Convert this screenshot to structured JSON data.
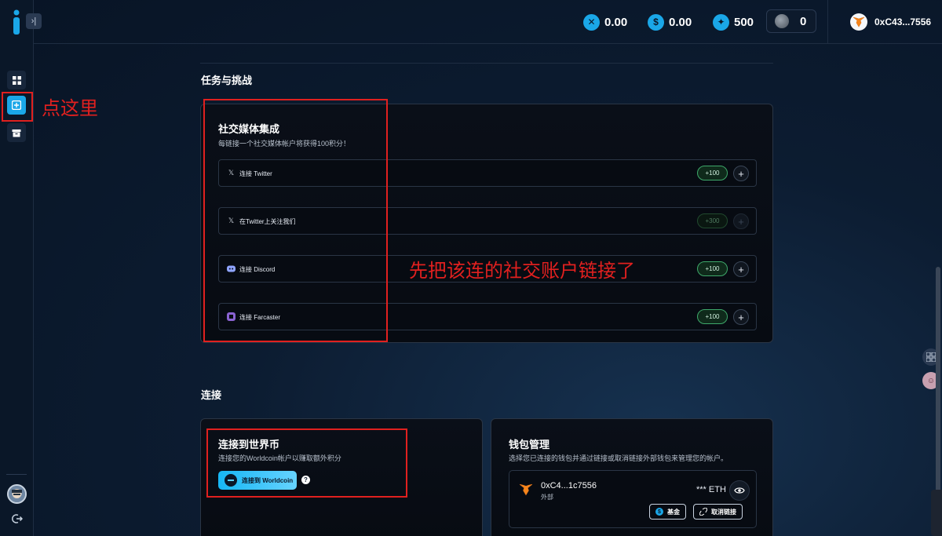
{
  "header": {
    "stats": [
      {
        "icon": "x-coin-icon",
        "value": "0.00"
      },
      {
        "icon": "dollar-coin-icon",
        "value": "0.00"
      },
      {
        "icon": "star-coin-icon",
        "value": "500"
      }
    ],
    "moon_value": "0",
    "wallet_address": "0xC43...7556"
  },
  "sidebar": {
    "items": [
      {
        "name": "dashboard",
        "icon": "grid-icon"
      },
      {
        "name": "tasks",
        "icon": "plus-square-icon",
        "active": true
      },
      {
        "name": "rewards",
        "icon": "box-icon"
      }
    ]
  },
  "tasks_section": {
    "title": "任务与挑战",
    "social_card": {
      "title": "社交媒体集成",
      "subtitle": "每链接一个社交媒体帐户将获得100积分！",
      "rows": [
        {
          "icon": "x-logo-icon",
          "label": "连接 Twitter",
          "points": "+100",
          "enabled": true
        },
        {
          "icon": "x-logo-icon",
          "label": "在Twitter上关注我们",
          "points": "+300",
          "enabled": false
        },
        {
          "icon": "discord-icon",
          "label": "连接 Discord",
          "points": "+100",
          "enabled": true
        },
        {
          "icon": "farcaster-icon",
          "label": "连接 Farcaster",
          "points": "+100",
          "enabled": true
        }
      ]
    }
  },
  "connect_section": {
    "title": "连接",
    "worldcoin_card": {
      "title": "连接到世界币",
      "subtitle": "连接您的Worldcoin帐户以赚取额外积分",
      "button_label": "连接到 Worldcoin",
      "help": "?"
    },
    "wallet_card": {
      "title": "钱包管理",
      "subtitle": "选择您已连接的钱包并通过链接或取消链接外部钱包来管理您的帐户。",
      "wallet": {
        "address": "0xC4...1c7556",
        "type": "外部",
        "balance_mask": "***",
        "currency": "ETH",
        "fund_label": "基金",
        "unlink_label": "取消链接"
      }
    }
  },
  "annotations": {
    "click_here": "点这里",
    "link_accounts": "先把该连的社交账户链接了"
  },
  "colors": {
    "accent": "#1aa7e8",
    "annotation": "#e0201f",
    "points_green": "#3ea86a"
  }
}
